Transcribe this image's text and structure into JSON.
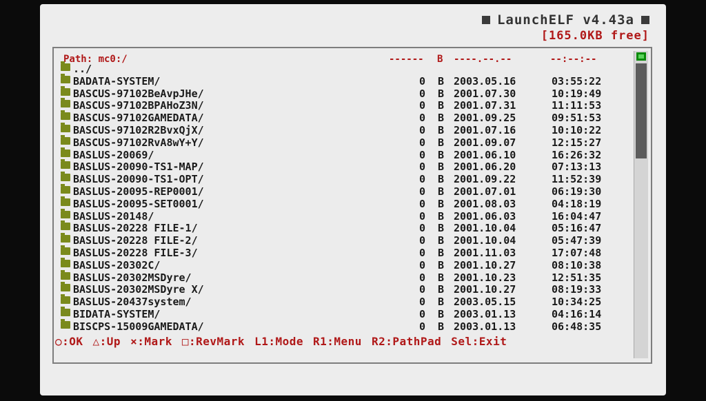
{
  "window": {
    "title": "LaunchELF v4.43a",
    "free": "[165.0KB free]"
  },
  "browser": {
    "path": "Path: mc0:/",
    "headers": {
      "size": "------",
      "unit": "B",
      "date": "----.--.--",
      "time": "--:--:--"
    },
    "rows": [
      {
        "name": "../",
        "size": "",
        "unit": "",
        "date": "",
        "time": ""
      },
      {
        "name": "BADATA-SYSTEM/",
        "size": "0",
        "unit": "B",
        "date": "2003.05.16",
        "time": "03:55:22"
      },
      {
        "name": "BASCUS-97102BeAvpJHe/",
        "size": "0",
        "unit": "B",
        "date": "2001.07.30",
        "time": "10:19:49"
      },
      {
        "name": "BASCUS-97102BPAHoZ3N/",
        "size": "0",
        "unit": "B",
        "date": "2001.07.31",
        "time": "11:11:53"
      },
      {
        "name": "BASCUS-97102GAMEDATA/",
        "size": "0",
        "unit": "B",
        "date": "2001.09.25",
        "time": "09:51:53"
      },
      {
        "name": "BASCUS-97102R2BvxQjX/",
        "size": "0",
        "unit": "B",
        "date": "2001.07.16",
        "time": "10:10:22"
      },
      {
        "name": "BASCUS-97102RvA8wY+Y/",
        "size": "0",
        "unit": "B",
        "date": "2001.09.07",
        "time": "12:15:27"
      },
      {
        "name": "BASLUS-20069/",
        "size": "0",
        "unit": "B",
        "date": "2001.06.10",
        "time": "16:26:32"
      },
      {
        "name": "BASLUS-20090-TS1-MAP/",
        "size": "0",
        "unit": "B",
        "date": "2001.06.20",
        "time": "07:13:13"
      },
      {
        "name": "BASLUS-20090-TS1-OPT/",
        "size": "0",
        "unit": "B",
        "date": "2001.09.22",
        "time": "11:52:39"
      },
      {
        "name": "BASLUS-20095-REP0001/",
        "size": "0",
        "unit": "B",
        "date": "2001.07.01",
        "time": "06:19:30"
      },
      {
        "name": "BASLUS-20095-SET0001/",
        "size": "0",
        "unit": "B",
        "date": "2001.08.03",
        "time": "04:18:19"
      },
      {
        "name": "BASLUS-20148/",
        "size": "0",
        "unit": "B",
        "date": "2001.06.03",
        "time": "16:04:47"
      },
      {
        "name": "BASLUS-20228 FILE-1/",
        "size": "0",
        "unit": "B",
        "date": "2001.10.04",
        "time": "05:16:47"
      },
      {
        "name": "BASLUS-20228 FILE-2/",
        "size": "0",
        "unit": "B",
        "date": "2001.10.04",
        "time": "05:47:39"
      },
      {
        "name": "BASLUS-20228 FILE-3/",
        "size": "0",
        "unit": "B",
        "date": "2001.11.03",
        "time": "17:07:48"
      },
      {
        "name": "BASLUS-20302C/",
        "size": "0",
        "unit": "B",
        "date": "2001.10.27",
        "time": "08:10:38"
      },
      {
        "name": "BASLUS-20302MSDyre/",
        "size": "0",
        "unit": "B",
        "date": "2001.10.23",
        "time": "12:51:35"
      },
      {
        "name": "BASLUS-20302MSDyre X/",
        "size": "0",
        "unit": "B",
        "date": "2001.10.27",
        "time": "08:19:33"
      },
      {
        "name": "BASLUS-20437system/",
        "size": "0",
        "unit": "B",
        "date": "2003.05.15",
        "time": "10:34:25"
      },
      {
        "name": "BIDATA-SYSTEM/",
        "size": "0",
        "unit": "B",
        "date": "2003.01.13",
        "time": "04:16:14"
      },
      {
        "name": "BISCPS-15009GAMEDATA/",
        "size": "0",
        "unit": "B",
        "date": "2003.01.13",
        "time": "06:48:35"
      }
    ]
  },
  "footer": [
    {
      "label": "○:OK",
      "icon": "circle-icon"
    },
    {
      "label": "△:Up",
      "icon": "triangle-icon"
    },
    {
      "label": "×:Mark",
      "icon": "cross-icon"
    },
    {
      "label": "□:RevMark",
      "icon": "square-icon"
    },
    {
      "label": "L1:Mode"
    },
    {
      "label": "R1:Menu"
    },
    {
      "label": "R2:PathPad"
    },
    {
      "label": "Sel:Exit"
    }
  ],
  "colors": {
    "accent": "#b01818",
    "folder": "#7a8a1c",
    "scroll_indicator": "#0a8a0a"
  }
}
